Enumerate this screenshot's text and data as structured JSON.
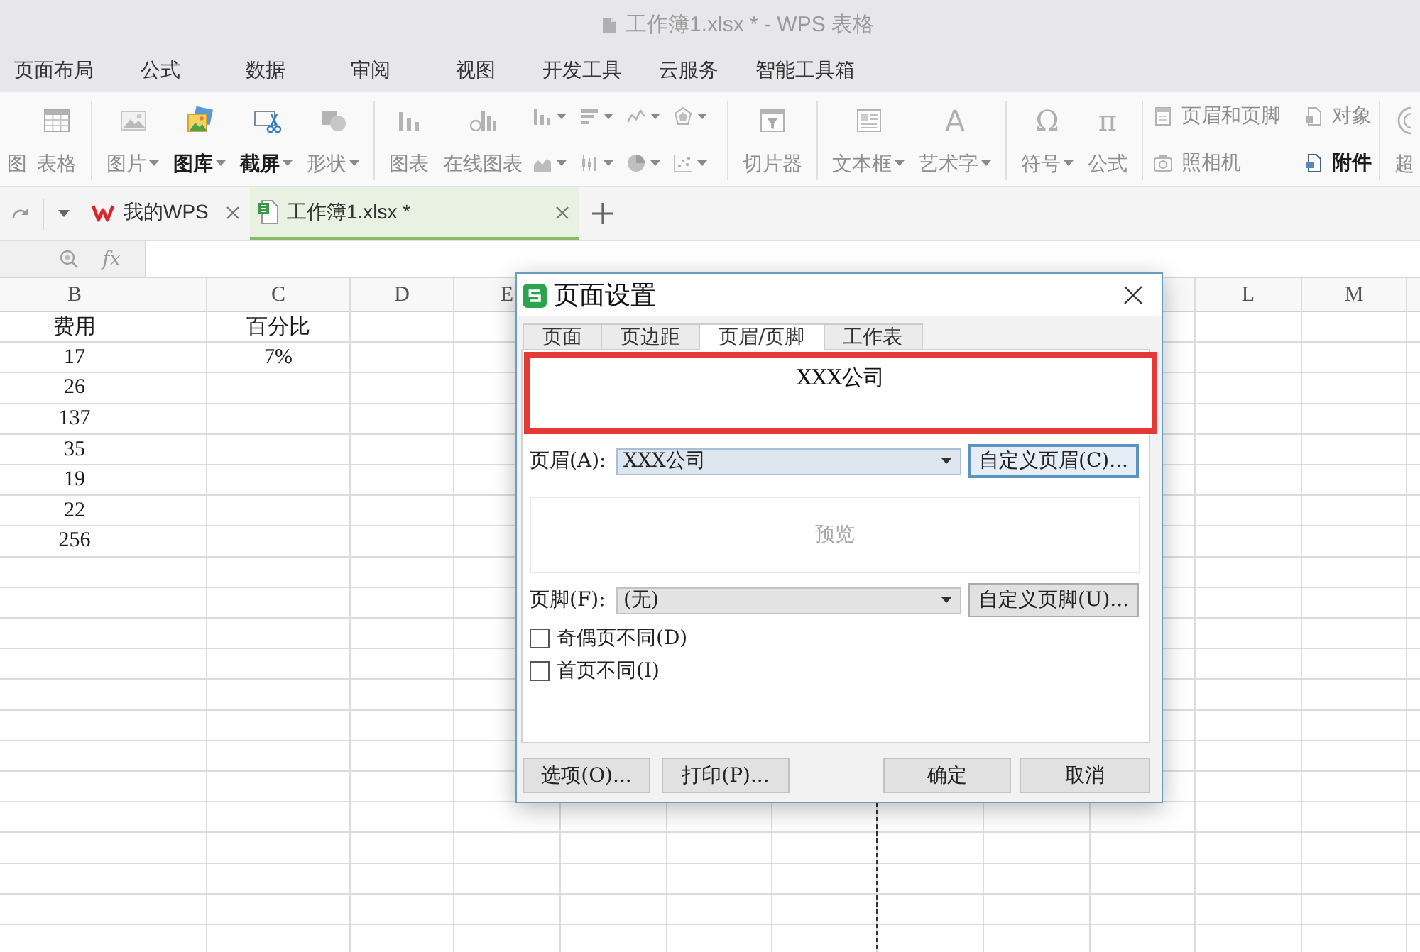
{
  "window": {
    "title": "工作簿1.xlsx * - WPS 表格"
  },
  "menu_tabs": [
    {
      "label": "页面布局",
      "selected": false
    },
    {
      "label": "公式",
      "selected": false
    },
    {
      "label": "数据",
      "selected": false
    },
    {
      "label": "审阅",
      "selected": false
    },
    {
      "label": "视图",
      "selected": false
    },
    {
      "label": "开发工具",
      "selected": false
    },
    {
      "label": "云服务",
      "selected": false
    },
    {
      "label": "智能工具箱",
      "selected": false
    }
  ],
  "ribbon": {
    "groups": [
      {
        "tools": [
          {
            "kind": "text",
            "label": "图",
            "disabled": true
          },
          {
            "kind": "large",
            "label": "表格",
            "disabled": true
          }
        ]
      },
      {
        "tools": [
          {
            "kind": "large",
            "label": "图片",
            "dropdown": true,
            "disabled": true
          },
          {
            "kind": "large",
            "label": "图库",
            "dropdown": true,
            "disabled": false
          },
          {
            "kind": "large",
            "label": "截屏",
            "dropdown": true,
            "disabled": false
          },
          {
            "kind": "large",
            "label": "形状",
            "dropdown": true,
            "disabled": true
          }
        ]
      },
      {
        "tools": [
          {
            "kind": "large",
            "label": "图表",
            "disabled": true
          },
          {
            "kind": "large",
            "label": "在线图表",
            "disabled": true
          },
          {
            "kind": "mini",
            "dropdown": true,
            "disabled": true
          },
          {
            "kind": "mini",
            "dropdown": true,
            "disabled": true
          },
          {
            "kind": "mini",
            "dropdown": true,
            "disabled": true
          },
          {
            "kind": "mini",
            "dropdown": true,
            "disabled": true
          },
          {
            "kind": "mini",
            "dropdown": true,
            "disabled": true
          },
          {
            "kind": "mini",
            "dropdown": true,
            "disabled": true
          },
          {
            "kind": "mini",
            "dropdown": true,
            "disabled": true
          },
          {
            "kind": "mini",
            "dropdown": true,
            "disabled": true
          }
        ]
      },
      {
        "tools": [
          {
            "kind": "large",
            "label": "切片器",
            "disabled": true
          }
        ]
      },
      {
        "tools": [
          {
            "kind": "large",
            "label": "文本框",
            "dropdown": true,
            "disabled": true
          },
          {
            "kind": "large",
            "label": "艺术字",
            "glyph": "A",
            "dropdown": true,
            "disabled": true
          }
        ]
      },
      {
        "tools": [
          {
            "kind": "large",
            "label": "符号",
            "glyph": "Ω",
            "dropdown": true,
            "disabled": true
          },
          {
            "kind": "large",
            "label": "公式",
            "glyph": "π",
            "disabled": true
          }
        ]
      },
      {
        "tools": [
          {
            "kind": "small",
            "label": "页眉和页脚",
            "disabled": true
          },
          {
            "kind": "small",
            "label": "对象",
            "disabled": true
          },
          {
            "kind": "small",
            "label": "照相机",
            "disabled": true
          },
          {
            "kind": "small",
            "label": "附件",
            "disabled": false
          }
        ]
      },
      {
        "tools": [
          {
            "kind": "large",
            "label": "超",
            "disabled": true
          }
        ]
      }
    ]
  },
  "doc_tabs": [
    {
      "label": "我的WPS",
      "selected": false
    },
    {
      "label": "工作簿1.xlsx *",
      "selected": true
    }
  ],
  "formula_bar": {
    "function_label": "fx"
  },
  "sheet": {
    "left_columns": [
      "B",
      "C",
      "D",
      "E"
    ],
    "right_columns": [
      "L",
      "M"
    ],
    "rows": [
      [
        "费用",
        "百分比"
      ],
      [
        "17",
        "7%"
      ],
      [
        "26"
      ],
      [
        "137"
      ],
      [
        "35"
      ],
      [
        "19"
      ],
      [
        "22"
      ],
      [
        "256"
      ]
    ]
  },
  "dialog": {
    "title": "页面设置",
    "tabs": [
      {
        "label": "页面",
        "selected": false
      },
      {
        "label": "页边距",
        "selected": false
      },
      {
        "label": "页眉/页脚",
        "selected": true
      },
      {
        "label": "工作表",
        "selected": false
      }
    ],
    "header_preview": {
      "text": "XXX公司",
      "highlighted": true
    },
    "header": {
      "label": "页眉(A):",
      "value": "XXX公司",
      "focused": true,
      "button": "自定义页眉(C)...",
      "button_focused": true
    },
    "preview": "预览",
    "footer": {
      "label": "页脚(F):",
      "value": "(无)",
      "focused": false,
      "button": "自定义页脚(U)...",
      "button_focused": false
    },
    "checkboxes": [
      {
        "label": "奇偶页不同(D)",
        "checked": false
      },
      {
        "label": "首页不同(I)",
        "checked": false
      }
    ],
    "left_buttons": [
      "选项(O)...",
      "打印(P)..."
    ],
    "right_buttons": [
      "确定",
      "取消"
    ]
  }
}
